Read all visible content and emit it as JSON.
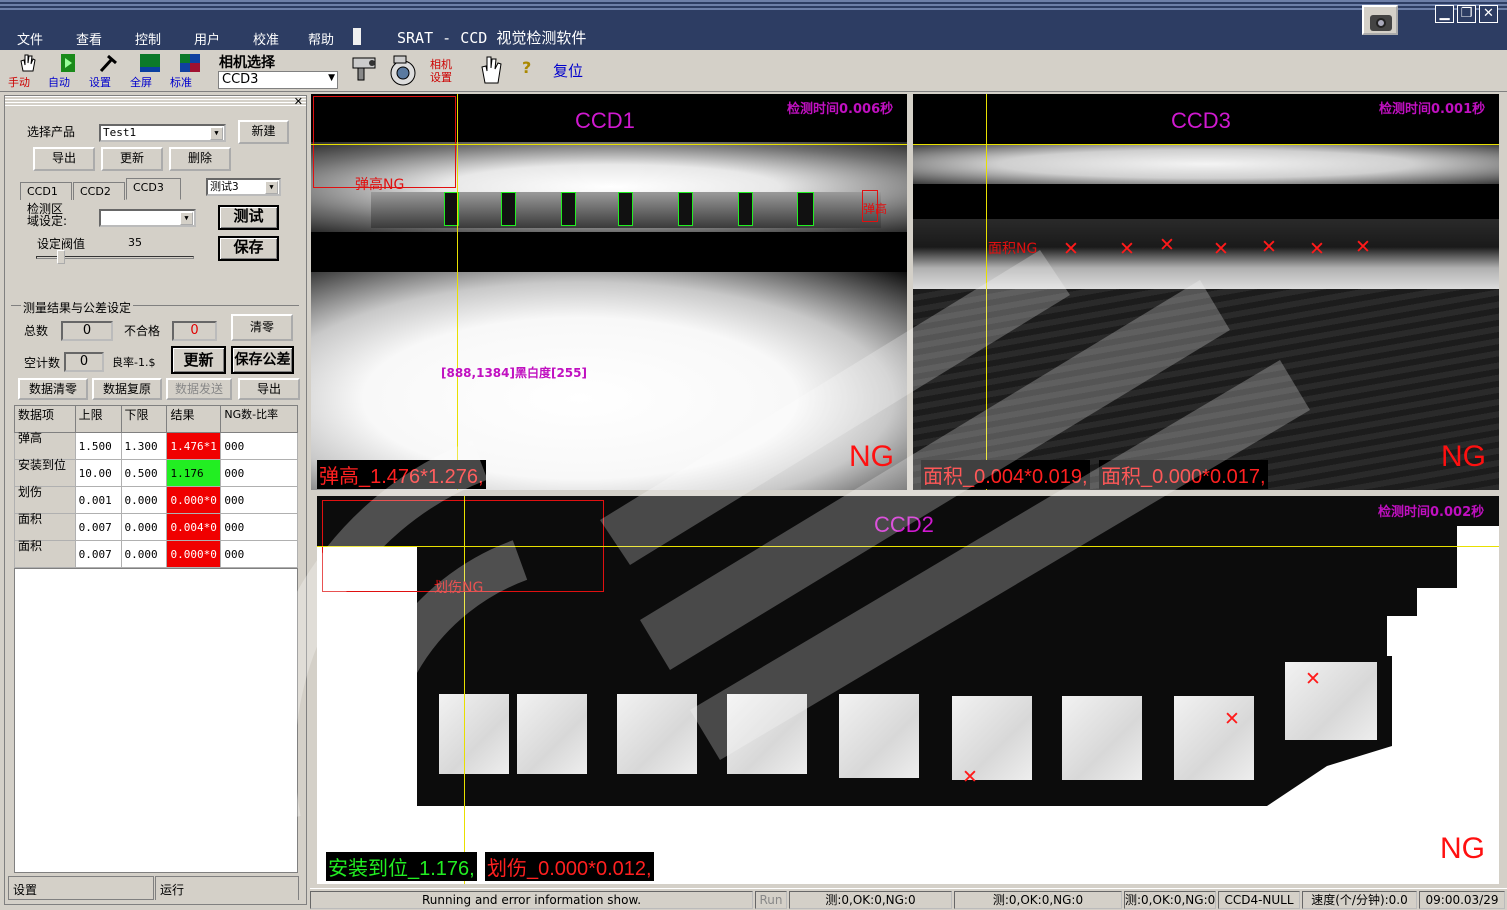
{
  "menu": {
    "items": [
      "文件",
      "查看",
      "控制",
      "用户",
      "校准",
      "帮助"
    ]
  },
  "app_title": "SRAT - CCD 视觉检测软件",
  "toolbar": {
    "manual": "手动",
    "auto": "自动",
    "settings": "设置",
    "fullscreen": "全屏",
    "calibrate": "标准",
    "camera_select_label": "相机选择",
    "camera_select_value": "CCD3",
    "camera_settings": "相机设置",
    "help": "?",
    "reset": "复位"
  },
  "left_panel": {
    "select_product_label": "选择产品",
    "product_value": "Test1",
    "new_button": "新建",
    "export_button": "导出",
    "update_button": "更新",
    "delete_button": "删除",
    "tabs": [
      "CCD1",
      "CCD2",
      "CCD3"
    ],
    "test_combo_value": "测试3",
    "detect_region_label": "检测区域设定:",
    "region_value": "",
    "test_button": "测试",
    "save_button": "保存",
    "threshold_label": "设定阀值",
    "threshold_value": "35",
    "group_title": "测量结果与公差设定",
    "total_label": "总数",
    "total_value": "0",
    "ng_label": "不合格",
    "ng_value": "0",
    "clear_button": "清零",
    "empty_count_label": "空计数",
    "empty_count_value": "0",
    "yield_label": "良率-1.$",
    "refresh_button": "更新",
    "save_tolerance_button": "保存公差",
    "data_clear_button": "数据清零",
    "data_restore_button": "数据复原",
    "data_send_button": "数据发送",
    "export2_button": "导出",
    "table": {
      "headers": [
        "数据项",
        "上限",
        "下限",
        "结果",
        "NG数-比率"
      ],
      "rows": [
        {
          "item": "弹高",
          "upper": "1.500",
          "lower": "1.300",
          "result": "1.476*1",
          "status": "red",
          "ng": "000"
        },
        {
          "item": "安装到位",
          "upper": "10.00",
          "lower": "0.500",
          "result": "1.176",
          "status": "green",
          "ng": "000"
        },
        {
          "item": "划伤",
          "upper": "0.001",
          "lower": "0.000",
          "result": "0.000*0",
          "status": "red",
          "ng": "000"
        },
        {
          "item": "面积",
          "upper": "0.007",
          "lower": "0.000",
          "result": "0.004*0",
          "status": "red",
          "ng": "000"
        },
        {
          "item": "面积",
          "upper": "0.007",
          "lower": "0.000",
          "result": "0.000*0",
          "status": "red",
          "ng": "000"
        }
      ]
    },
    "bottom_tabs": [
      "设置",
      "运行"
    ]
  },
  "views": {
    "ccd1": {
      "label": "CCD1",
      "time": "检测时间0.006秒",
      "roi_label": "弹高NG",
      "roi_label2": "弹高NG",
      "pixel_info": "[888,1384]黑白度[255]",
      "status": "NG",
      "result": "弹高_1.476*1.276,"
    },
    "ccd3": {
      "label": "CCD3",
      "time": "检测时间0.001秒",
      "roi_label": "面积NG",
      "status": "NG",
      "result1": "面积_0.004*0.019,",
      "result2": "面积_0.000*0.017,"
    },
    "ccd2": {
      "label": "CCD2",
      "time": "检测时间0.002秒",
      "roi_label": "划伤NG",
      "status": "NG",
      "result1": "安装到位_1.176,",
      "result2": "划伤_0.000*0.012,"
    }
  },
  "statusbar": {
    "message": "Running and error information show.",
    "run": "Run",
    "counter1": "测:0,OK:0,NG:0",
    "counter2": "测:0,OK:0,NG:0",
    "counter3": "测:0,OK:0,NG:0",
    "ccd4": "CCD4-NULL",
    "speed": "速度(个/分钟):0.0",
    "time": "09:00.03/29"
  },
  "colors": {
    "ok": "#22ee22",
    "ng": "#f00000",
    "label_magenta": "#d019d0",
    "guide_yellow": "#e8e000"
  }
}
